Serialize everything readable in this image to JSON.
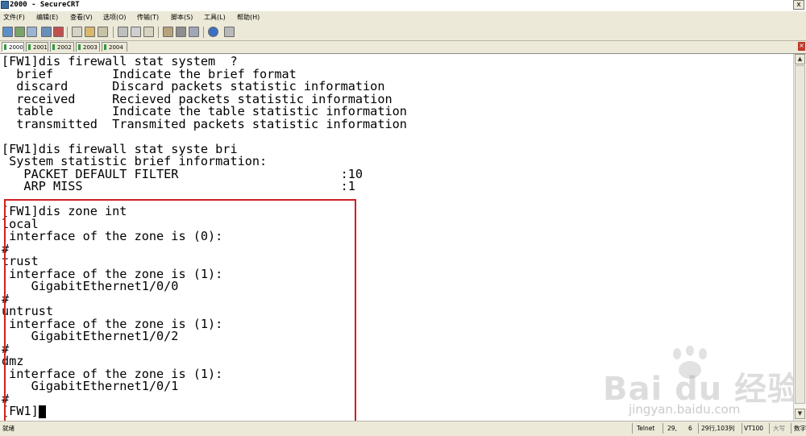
{
  "window": {
    "title": "2000 - SecureCRT",
    "buttons": {
      "close": "x"
    }
  },
  "menu": [
    "文件(F)",
    "编辑(E)",
    "查看(V)",
    "选项(O)",
    "传输(T)",
    "脚本(S)",
    "工具(L)",
    "帮助(H)"
  ],
  "toolbar": {
    "icons": [
      "connect-icon",
      "quick-connect-icon",
      "connect-tab-icon",
      "reconnect-icon",
      "disconnect-icon",
      "copy-icon",
      "paste-icon",
      "find-icon",
      "print-icon",
      "print-setup-icon",
      "session-options-icon",
      "global-options-icon",
      "keymap-icon",
      "sftp-icon",
      "help-icon",
      "options-dropdown-icon"
    ]
  },
  "tabs": [
    {
      "label": "2000",
      "active": true
    },
    {
      "label": "2001",
      "active": false
    },
    {
      "label": "2002",
      "active": false
    },
    {
      "label": "2003",
      "active": false
    },
    {
      "label": "2004",
      "active": false
    }
  ],
  "terminal": {
    "lines": [
      "[FW1]dis firewall stat system  ?",
      "  brief        Indicate the brief format",
      "  discard      Discard packets statistic information",
      "  received     Recieved packets statistic information",
      "  table        Indicate the table statistic information",
      "  transmitted  Transmited packets statistic information",
      "",
      "[FW1]dis firewall stat syste bri",
      " System statistic brief information:",
      "   PACKET DEFAULT FILTER                      :10",
      "   ARP MISS                                   :1",
      "",
      "[FW1]dis zone int",
      "local",
      " interface of the zone is (0):",
      "#",
      "trust",
      " interface of the zone is (1):",
      "    GigabitEthernet1/0/0",
      "#",
      "untrust",
      " interface of the zone is (1):",
      "    GigabitEthernet1/0/2",
      "#",
      "dmz",
      " interface of the zone is (1):",
      "    GigabitEthernet1/0/1",
      "#",
      "[FW1]"
    ]
  },
  "watermark": {
    "brand": "Bai du 经验",
    "url": "jingyan.baidu.com"
  },
  "statusbar": {
    "ready": "就绪",
    "protocol": "Telnet",
    "row": "29,",
    "col": "6",
    "size": "29行,103列",
    "emulation": "VT100",
    "caps": "大写",
    "num": "数字"
  }
}
